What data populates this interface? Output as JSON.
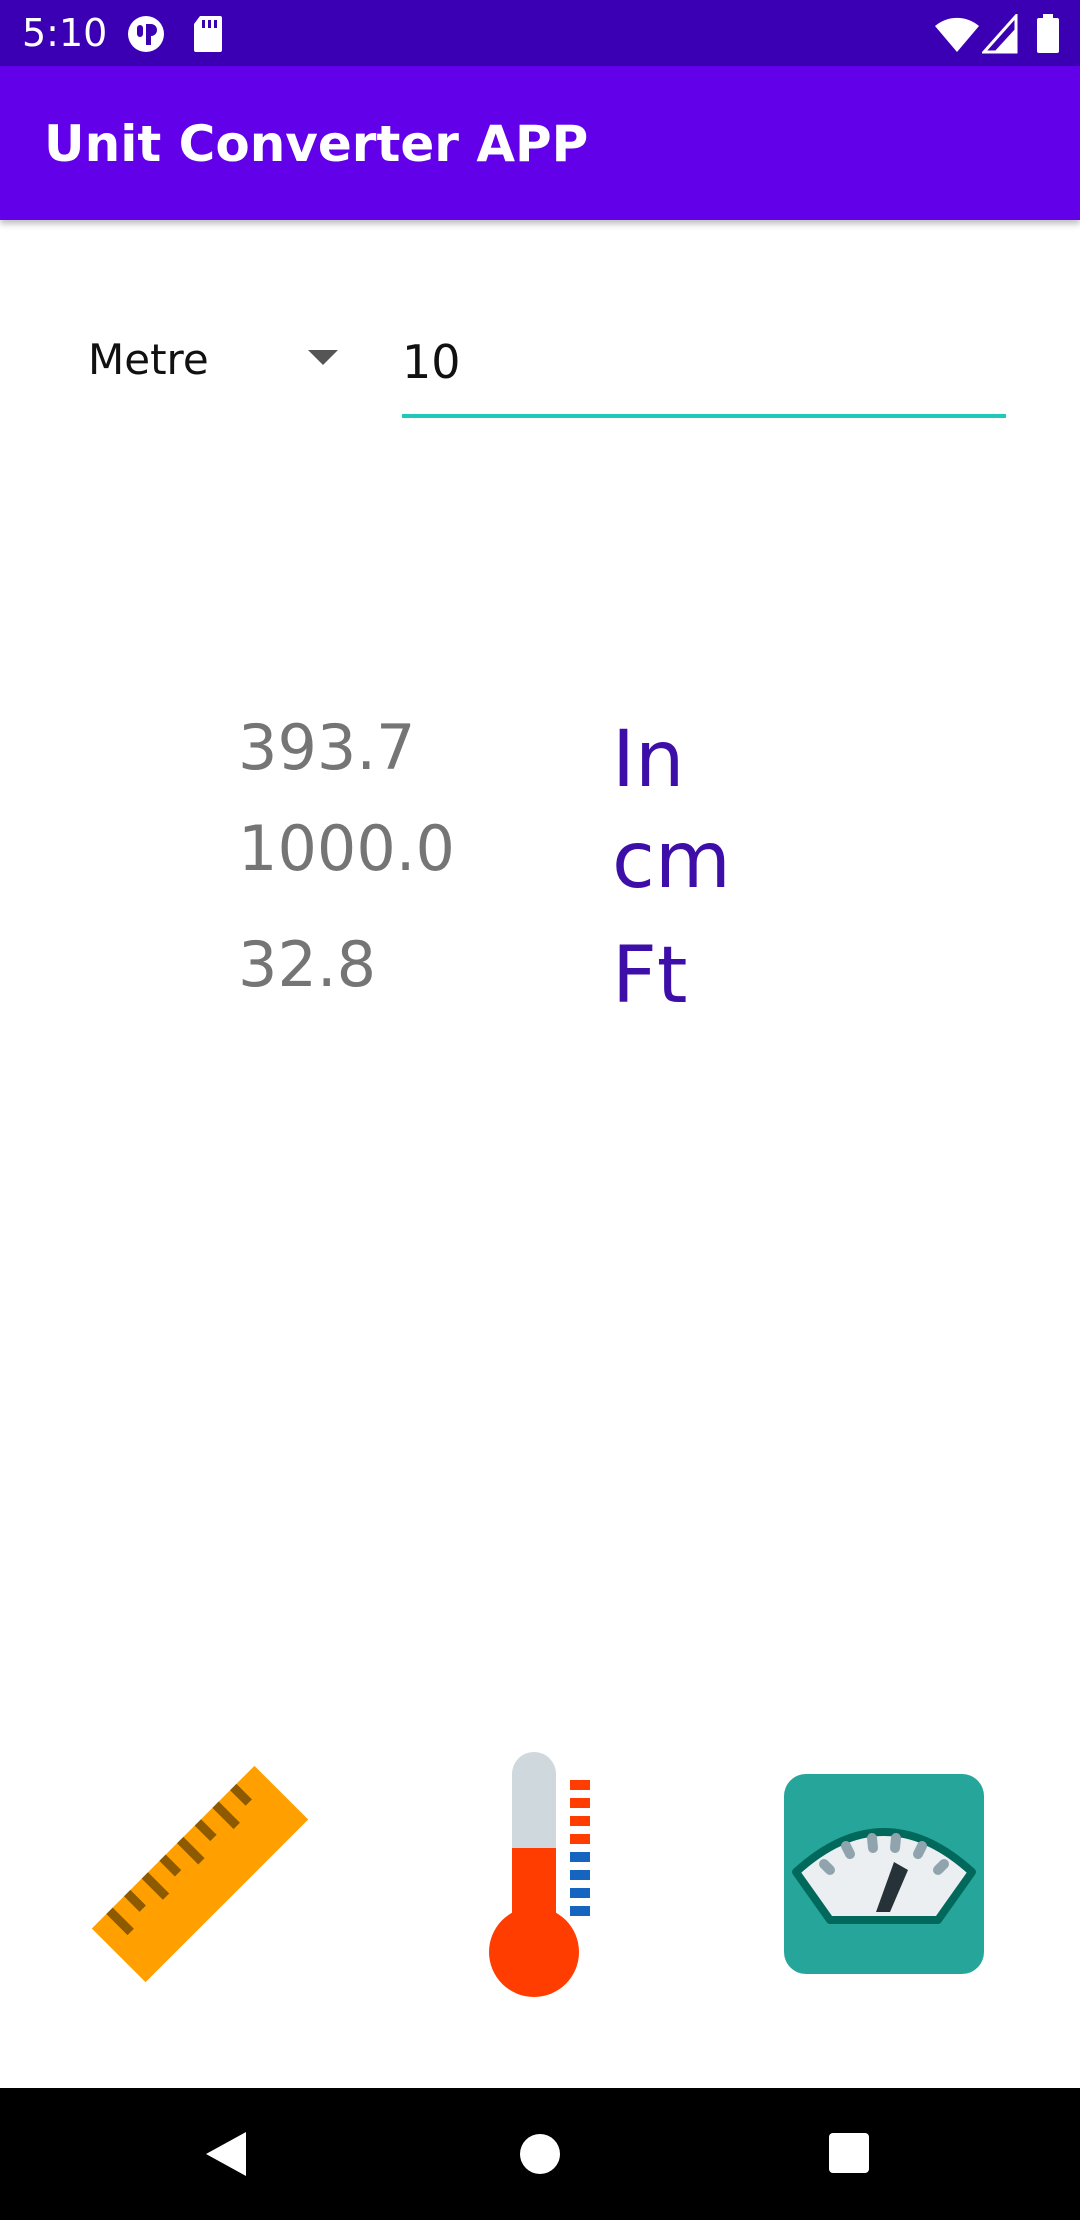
{
  "status_bar": {
    "time": "5:10",
    "icons": [
      "app-notification-icon",
      "sd-card-icon",
      "wifi-icon",
      "signal-icon",
      "battery-icon"
    ]
  },
  "app_bar": {
    "title": "Unit Converter APP"
  },
  "converter": {
    "unit_selected": "Metre",
    "input_value": "10"
  },
  "results": [
    {
      "value": "393.7",
      "unit": "In"
    },
    {
      "value": "1000.0",
      "unit": "cm"
    },
    {
      "value": "32.8",
      "unit": "Ft"
    }
  ],
  "categories": [
    "ruler-icon",
    "thermometer-icon",
    "weighing-scale-icon"
  ],
  "colors": {
    "status_bar": "#3c00b4",
    "app_bar": "#6200ea",
    "accent_underline": "#1fc8b8",
    "unit_text": "#3e0fa8",
    "value_text": "#757575"
  },
  "nav": [
    "back-icon",
    "home-icon",
    "recents-icon"
  ]
}
